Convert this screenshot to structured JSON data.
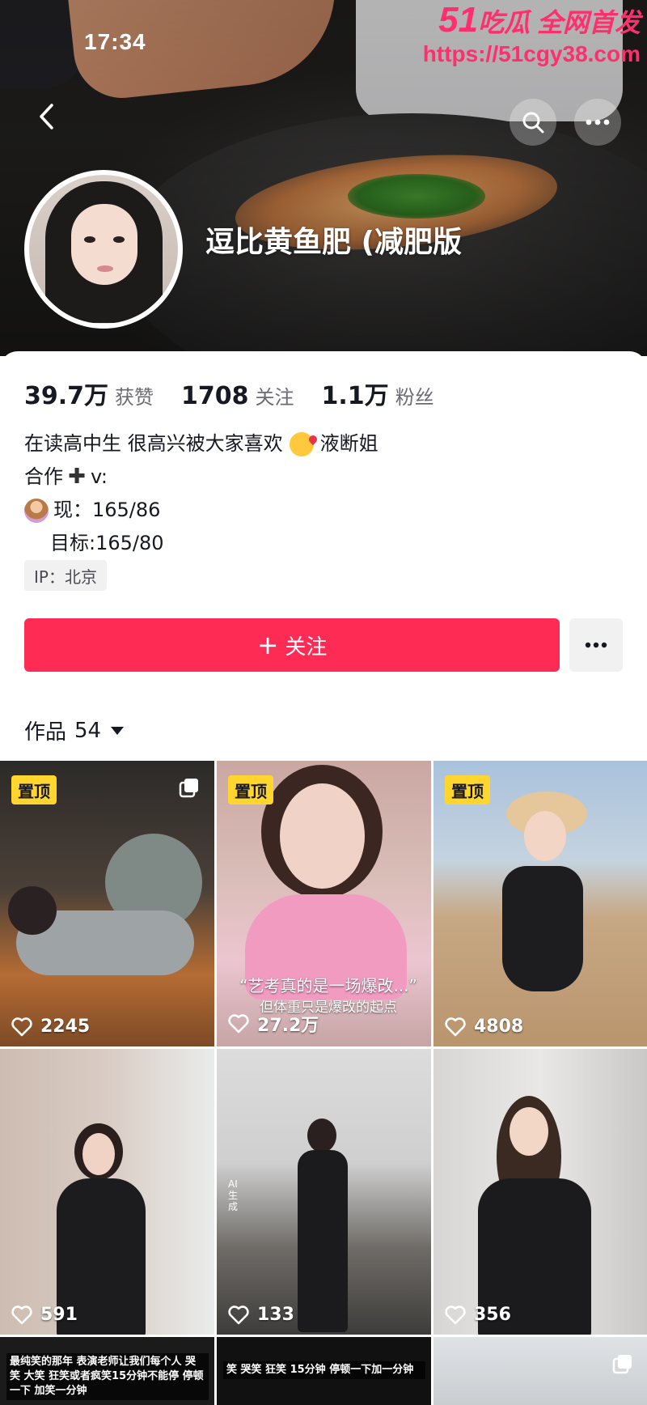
{
  "status_bar": {
    "time": "17:34"
  },
  "watermark": {
    "num": "51",
    "brand": "吃瓜 全网首发",
    "url": "https://51cgy38.com"
  },
  "header": {
    "nickname": "逗比黄鱼肥 (减肥版",
    "icons": [
      "back-icon",
      "search-icon",
      "more-icon"
    ]
  },
  "stats": [
    {
      "value": "39.7万",
      "label": "获赞"
    },
    {
      "value": "1708",
      "label": "关注"
    },
    {
      "value": "1.1万",
      "label": "粉丝"
    }
  ],
  "bio": {
    "line1_a": "在读高中生 很高兴被大家喜欢",
    "line1_b": "液断姐",
    "line2": "合作",
    "line2_tail": "v:",
    "line3": "现：165/86",
    "line4": "目标:165/80"
  },
  "ip_tag": "IP：北京",
  "actions": {
    "follow_label": "关注",
    "follow_plus": "+"
  },
  "works_tab": {
    "label": "作品",
    "count": "54"
  },
  "videos": [
    {
      "pinned": true,
      "pin_label": "置顶",
      "likes": "2245",
      "multi": true
    },
    {
      "pinned": true,
      "pin_label": "置顶",
      "likes": "27.2万",
      "caption": "“艺考真的是一场爆改...”",
      "caption2": "但体重只是爆改的起点"
    },
    {
      "pinned": true,
      "pin_label": "置顶",
      "likes": "4808"
    },
    {
      "pinned": false,
      "likes": "591"
    },
    {
      "pinned": false,
      "likes": "133",
      "side_text": "AI生成"
    },
    {
      "pinned": false,
      "likes": "356"
    },
    {
      "pinned": false,
      "text": "最纯笑的那年 表演老师让我们每个人 哭笑 大笑 狂笑或者疯笑15分钟不能停 停顿一下 加笑一分钟"
    },
    {
      "pinned": false,
      "text": "笑 哭笑 狂笑 15分钟 停顿一下加一分钟"
    },
    {
      "pinned": false,
      "multi": true
    }
  ],
  "colors": {
    "accent": "#fe2c55",
    "pin": "#ffd52e",
    "watermark": "#ff2f6e"
  }
}
